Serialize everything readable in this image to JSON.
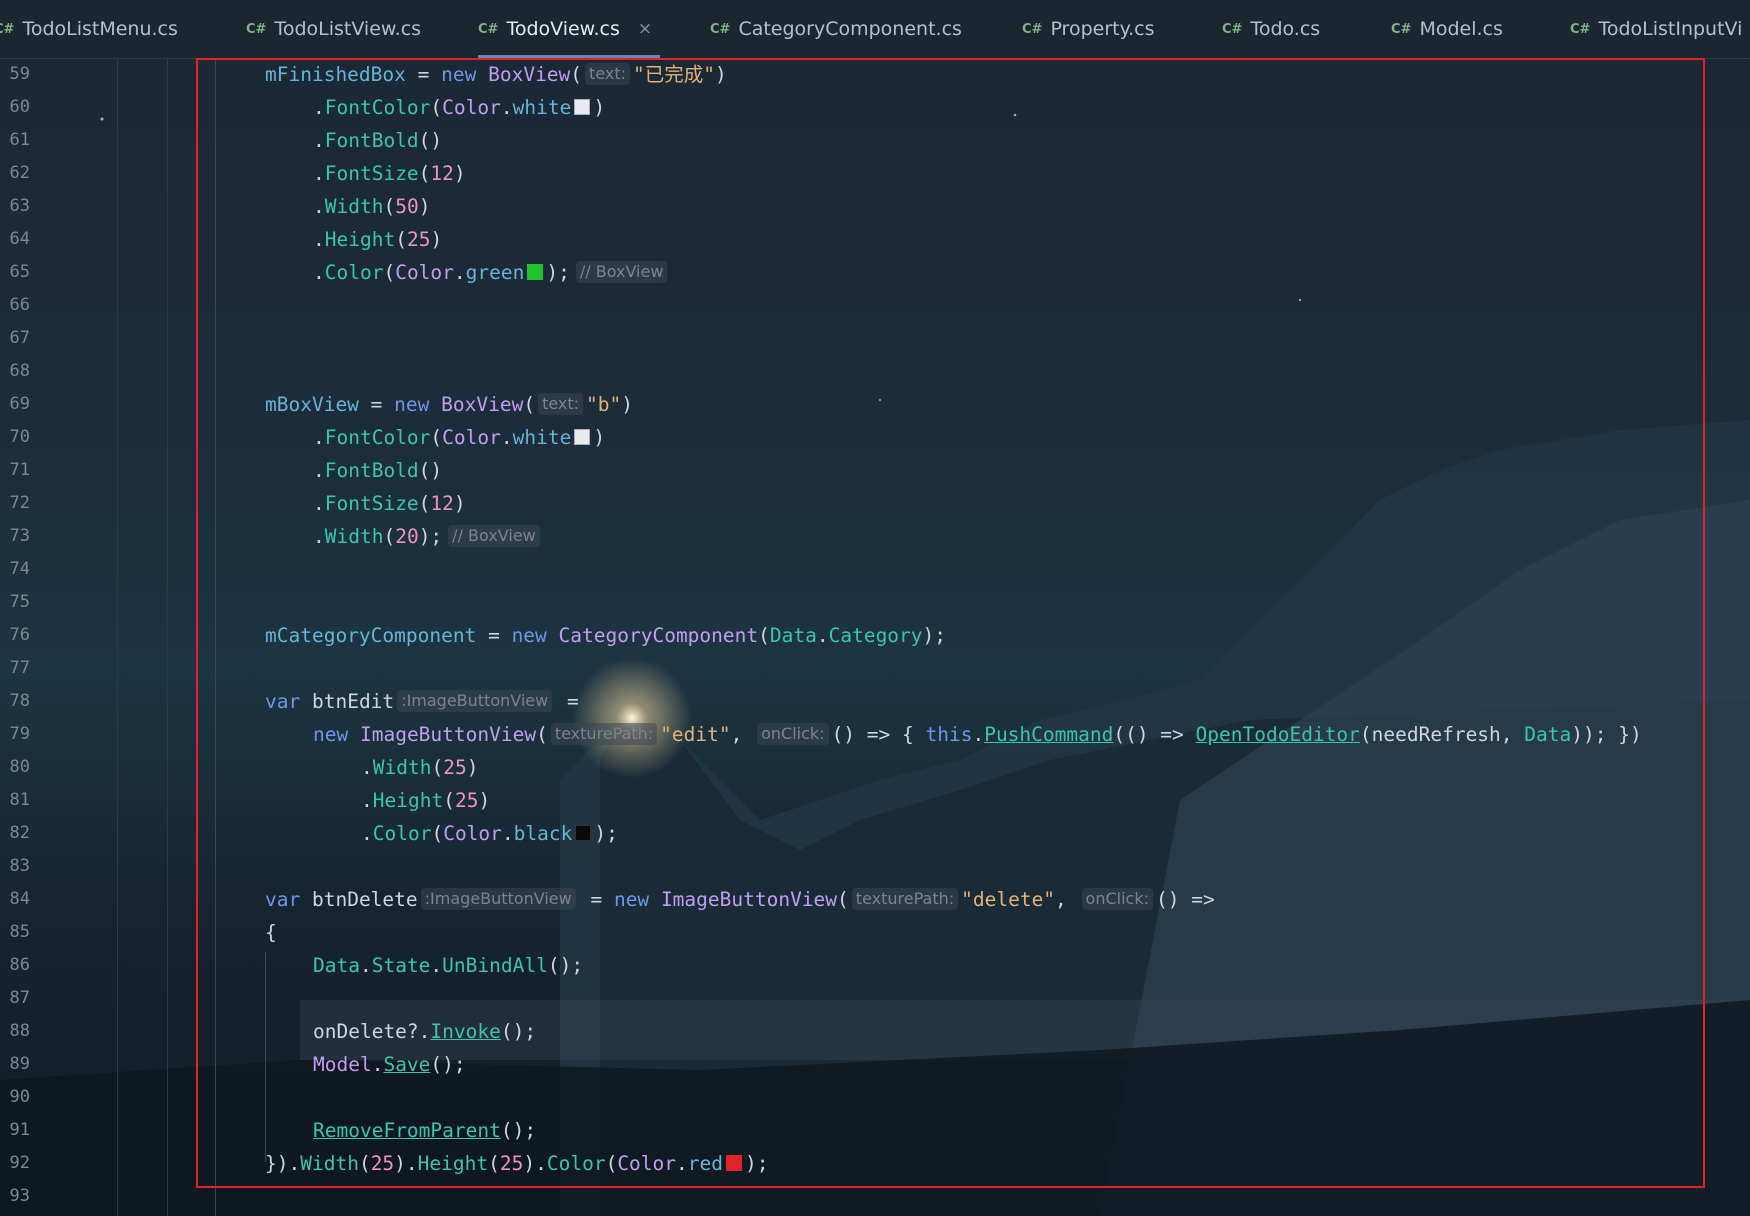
{
  "tabs": [
    {
      "lang": "C#",
      "label": "TodoListMenu.cs",
      "active": false
    },
    {
      "lang": "C#",
      "label": "TodoListView.cs",
      "active": false
    },
    {
      "lang": "C#",
      "label": "TodoView.cs",
      "active": true,
      "close": "×"
    },
    {
      "lang": "C#",
      "label": "CategoryComponent.cs",
      "active": false
    },
    {
      "lang": "C#",
      "label": "Property.cs",
      "active": false
    },
    {
      "lang": "C#",
      "label": "Todo.cs",
      "active": false
    },
    {
      "lang": "C#",
      "label": "Model.cs",
      "active": false
    },
    {
      "lang": "C#",
      "label": "TodoListInputVi",
      "active": false
    }
  ],
  "colors": {
    "swatch_white": "#e8eaee",
    "swatch_green": "#1fc42c",
    "swatch_black": "#0a0a0a",
    "swatch_red": "#e0242a",
    "highlight_box": "#e0242a"
  },
  "editor": {
    "line_numbers": [
      "59",
      "60",
      "61",
      "62",
      "63",
      "64",
      "65",
      "66",
      "67",
      "68",
      "69",
      "70",
      "71",
      "72",
      "73",
      "74",
      "75",
      "76",
      "77",
      "78",
      "79",
      "80",
      "81",
      "82",
      "83",
      "84",
      "85",
      "86",
      "87",
      "88",
      "89",
      "90",
      "91",
      "92",
      "93"
    ],
    "t": {
      "mFinishedBox": "mFinishedBox",
      "eq": " = ",
      "eq_tail": " =",
      "new": "new",
      "BoxView": "BoxView",
      "paren_open": "(",
      "paren_close": ")",
      "close_semi": ");",
      "semi_tail": "();",
      "hint_text": "text:",
      "str_finished": "\"已完成\"",
      "str_b": "\"b\"",
      "dot": ".",
      "FontColor": "FontColor",
      "Color": "Color",
      "white": "white",
      "FontBold": "FontBold",
      "empty_parens": "()",
      "FontSize": "FontSize",
      "n12": "12",
      "Width": "Width",
      "n50": "50",
      "Height": "Height",
      "n25": "25",
      "n20": "20",
      "green": "green",
      "cmt_boxview": "// BoxView",
      "mBoxView": "mBoxView",
      "mCategoryComponent": "mCategoryComponent",
      "CategoryComponent": "CategoryComponent",
      "Data": "Data",
      "Category": "Category",
      "var": "var",
      "btnEdit": "btnEdit",
      "hint_ibv": ":ImageButtonView",
      "ImageButtonView": "ImageButtonView",
      "hint_texturePath": "texturePath:",
      "str_edit": "\"edit\"",
      "comma": ", ",
      "hint_onClick": "onClick:",
      "lambda_open": "() => { ",
      "this": "this",
      "PushCommand": "PushCommand",
      "lambda_inner": "(() => ",
      "OpenTodoEditor": "OpenTodoEditor",
      "args_open": "(needRefresh, ",
      "args_close": ")); })",
      "black": "black",
      "btnDelete": "btnDelete",
      "str_delete": "\"delete\"",
      "lambda_arrow": "() =>",
      "brace_open": "{",
      "State": "State",
      "UnBindAll": "UnBindAll",
      "onDelete": "onDelete",
      "qdot": "?.",
      "Invoke": "Invoke",
      "Model": "Model",
      "Save": "Save",
      "RemoveFromParent": "RemoveFromParent",
      "brace_paren": "})",
      "red": "red"
    }
  }
}
